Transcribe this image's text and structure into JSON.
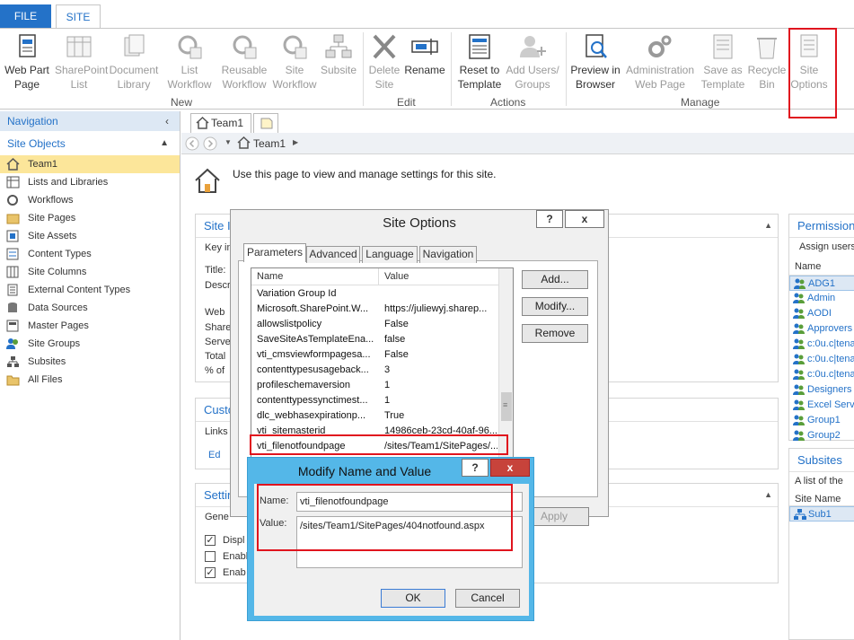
{
  "tabs": {
    "file": "FILE",
    "site": "SITE"
  },
  "ribbon": {
    "web_part_page": "Web Part Page",
    "sharepoint_list": "SharePoint List",
    "document_library": "Document Library",
    "list_workflow": "List Workflow",
    "reusable_workflow": "Reusable Workflow",
    "site_workflow": "Site Workflow",
    "subsite": "Subsite",
    "delete_site": "Delete Site",
    "rename": "Rename",
    "reset_to_template": "Reset to Template",
    "add_users_groups": "Add Users/ Groups",
    "preview_in_browser": "Preview in Browser",
    "administration_web_page": "Administration Web Page",
    "save_as_template": "Save as Template",
    "recycle_bin": "Recycle Bin",
    "site_options": "Site Options",
    "groups": {
      "new": "New",
      "edit": "Edit",
      "actions": "Actions",
      "manage": "Manage"
    }
  },
  "nav": {
    "header": "Navigation",
    "section": "Site Objects",
    "items": [
      "Team1",
      "Lists and Libraries",
      "Workflows",
      "Site Pages",
      "Site Assets",
      "Content Types",
      "Site Columns",
      "External Content Types",
      "Data Sources",
      "Master Pages",
      "Site Groups",
      "Subsites",
      "All Files"
    ]
  },
  "doc_tab": "Team1",
  "breadcrumb": "Team1",
  "page_intro": "Use this page to view and manage settings for this site.",
  "main_fragments": {
    "site_info_head": "Site I",
    "key_info": "Key in",
    "title": "Title:",
    "desc": "Descr",
    "web": "Web",
    "share": "Share",
    "serve": "Serve",
    "total": "Total",
    "pct": "% of",
    "custom_head": "Custo",
    "links": "Links",
    "ed": "Ed",
    "settings_head": "Settin",
    "general": "Gene",
    "disp": "Displ",
    "enab1": "Enabl",
    "enab2": "Enab"
  },
  "right_panels": {
    "permissions": {
      "head": "Permission",
      "sub": "Assign users",
      "col": "Name",
      "items": [
        "ADG1",
        "Admin",
        "AODI",
        "Approvers",
        "c:0u.c|tena",
        "c:0u.c|tena",
        "c:0u.c|tena",
        "Designers",
        "Excel Servi",
        "Group1",
        "Group2"
      ]
    },
    "subsites": {
      "head": "Subsites",
      "sub": "A list of the",
      "col": "Site Name",
      "items": [
        "Sub1"
      ]
    }
  },
  "site_options_dialog": {
    "title": "Site Options",
    "help": "?",
    "close": "x",
    "tabs": [
      "Parameters",
      "Advanced",
      "Language",
      "Navigation"
    ],
    "col_name": "Name",
    "col_value": "Value",
    "rows": [
      {
        "name": "Variation Group Id",
        "value": ""
      },
      {
        "name": "Microsoft.SharePoint.W...",
        "value": "https://juliewyj.sharep..."
      },
      {
        "name": "allowslistpolicy",
        "value": "False"
      },
      {
        "name": "SaveSiteAsTemplateEna...",
        "value": "false"
      },
      {
        "name": "vti_cmsviewformpagesa...",
        "value": "False"
      },
      {
        "name": "contenttypesusageback...",
        "value": "3"
      },
      {
        "name": "profileschemaversion",
        "value": "1"
      },
      {
        "name": "contenttypessynctimest...",
        "value": "1"
      },
      {
        "name": "dlc_webhasexpirationp...",
        "value": "True"
      },
      {
        "name": "vti_sitemasterid",
        "value": "14986ceb-23cd-40af-96..."
      },
      {
        "name": "vti_filenotfoundpage",
        "value": "/sites/Team1/SitePages/..."
      }
    ],
    "add": "Add...",
    "modify": "Modify...",
    "remove": "Remove",
    "apply": "Apply"
  },
  "modify_dialog": {
    "title": "Modify Name and Value",
    "help": "?",
    "close": "x",
    "name_label": "Name:",
    "name_value": "vti_filenotfoundpage",
    "value_label": "Value:",
    "value_value": "/sites/Team1/SitePages/404notfound.aspx",
    "ok": "OK",
    "cancel": "Cancel"
  },
  "colors": {
    "accent": "#2472c8",
    "highlight": "#e0141e",
    "selected": "#fce69a",
    "dialog_frame": "#54b7e8"
  }
}
